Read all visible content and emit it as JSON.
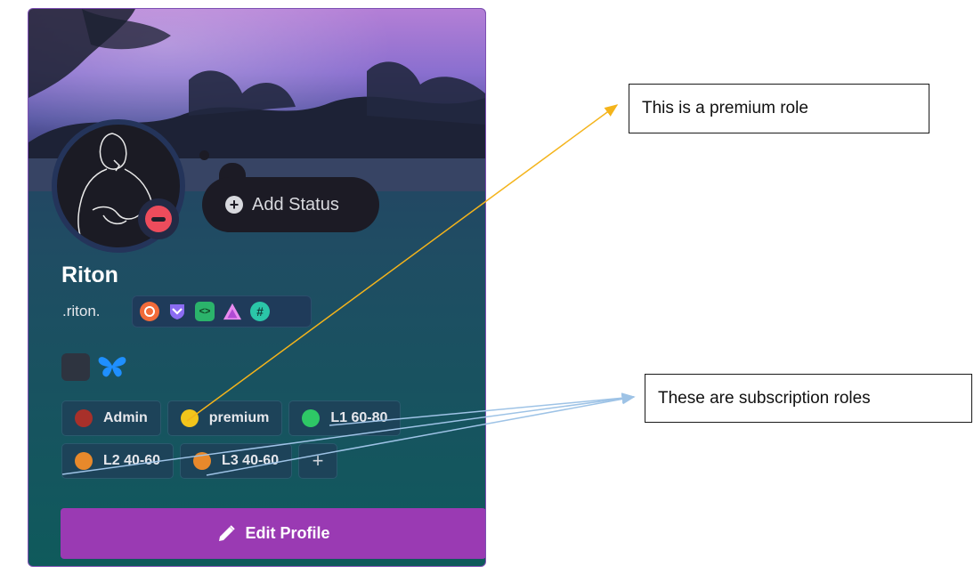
{
  "profile": {
    "display_name": "Riton",
    "username": ".riton.",
    "add_status_label": "Add Status",
    "edit_profile_label": "Edit Profile",
    "badges": [
      "orange-ring-badge",
      "purple-shield-badge",
      "green-code-badge",
      "pink-triangle-badge",
      "teal-hash-badge"
    ],
    "hash_symbol": "#",
    "code_symbol": "<>",
    "connections": [
      "app-square",
      "butterfly-icon"
    ]
  },
  "roles": [
    {
      "name": "Admin",
      "color": "#a8302a"
    },
    {
      "name": "premium",
      "color": "#f2c51b"
    },
    {
      "name": "L1 60-80",
      "color": "#2ec866"
    },
    {
      "name": "L2 40-60",
      "color": "#e8892b"
    },
    {
      "name": "L3 40-60",
      "color": "#e8892b"
    }
  ],
  "add_role_symbol": "+",
  "annotations": {
    "premium_note": "This is a premium role",
    "subscription_note": "These are subscription roles",
    "premium_arrow_color": "#f4b41b",
    "subscription_arrow_color": "#9ec3e6"
  }
}
